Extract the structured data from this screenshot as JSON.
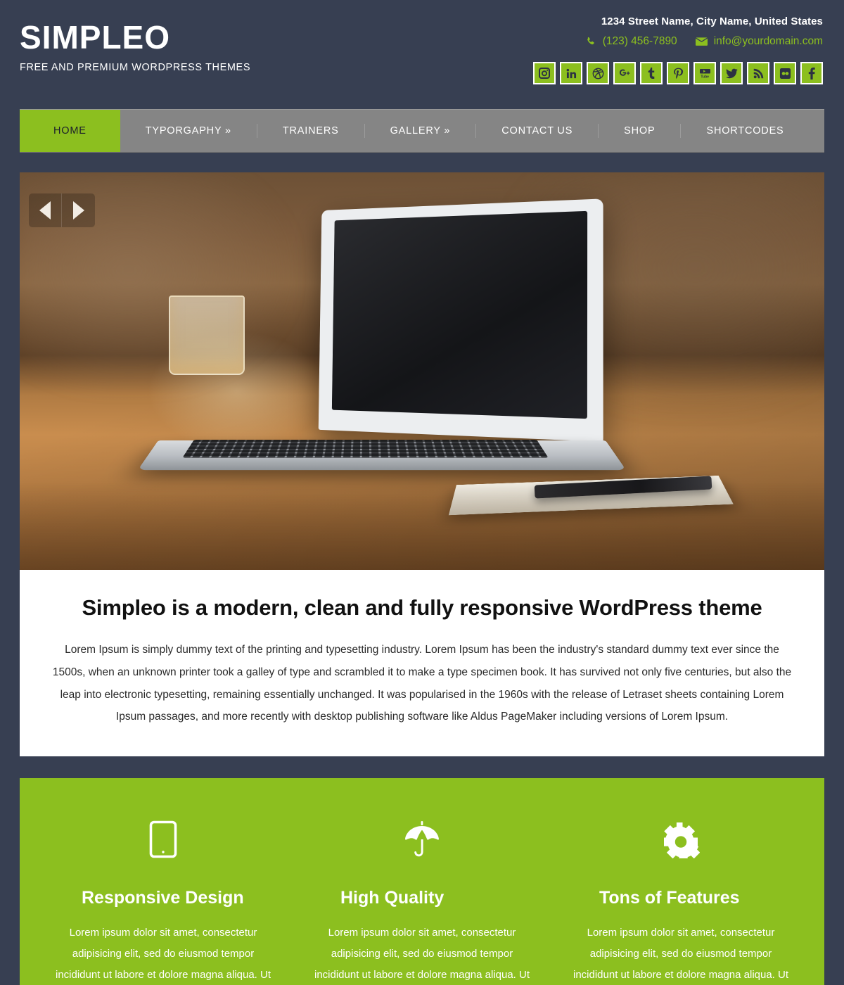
{
  "header": {
    "brand_title": "SIMPLEO",
    "brand_tagline": "FREE AND PREMIUM WORDPRESS THEMES",
    "address": "1234 Street Name, City Name, United States",
    "phone": "(123) 456-7890",
    "email": "info@yourdomain.com",
    "phone_icon": "phone-icon",
    "email_icon": "envelope-icon",
    "social": [
      {
        "name": "instagram-icon",
        "label": "Instagram"
      },
      {
        "name": "linkedin-icon",
        "label": "LinkedIn"
      },
      {
        "name": "dribbble-icon",
        "label": "Dribbble"
      },
      {
        "name": "google-plus-icon",
        "label": "Google Plus"
      },
      {
        "name": "tumblr-icon",
        "label": "Tumblr"
      },
      {
        "name": "pinterest-icon",
        "label": "Pinterest"
      },
      {
        "name": "youtube-icon",
        "label": "YouTube"
      },
      {
        "name": "twitter-icon",
        "label": "Twitter"
      },
      {
        "name": "rss-icon",
        "label": "RSS"
      },
      {
        "name": "flickr-icon",
        "label": "Flickr"
      },
      {
        "name": "facebook-icon",
        "label": "Facebook"
      }
    ]
  },
  "nav": {
    "items": [
      {
        "label": "HOME",
        "active": true
      },
      {
        "label": "TYPORGAPHY »",
        "active": false
      },
      {
        "label": "TRAINERS",
        "active": false
      },
      {
        "label": "GALLERY »",
        "active": false
      },
      {
        "label": "CONTACT US",
        "active": false
      },
      {
        "label": "SHOP",
        "active": false
      },
      {
        "label": "SHORTCODES",
        "active": false
      }
    ]
  },
  "slider": {
    "prev_label": "◀",
    "next_label": "▶",
    "image_alt": "MacBook Air laptop on wooden desk with glass of water, notebook and pen"
  },
  "intro": {
    "title": "Simpleo is a modern, clean and fully responsive WordPress theme",
    "text": "Lorem Ipsum is simply dummy text of the printing and typesetting industry. Lorem Ipsum has been the industry's standard dummy text ever since the 1500s, when an unknown printer took a galley of type and scrambled it to make a type specimen book. It has survived not only five centuries, but also the leap into electronic typesetting, remaining essentially unchanged. It was popularised in the 1960s with the release of Letraset sheets containing Lorem Ipsum passages, and more recently with desktop publishing software like Aldus PageMaker including versions of Lorem Ipsum."
  },
  "features": [
    {
      "icon": "tablet-icon",
      "title": "Responsive Design",
      "text": "Lorem ipsum dolor sit amet, consectetur adipisicing elit, sed do eiusmod tempor incididunt ut labore et dolore magna aliqua. Ut"
    },
    {
      "icon": "umbrella-icon",
      "title": "High Quality",
      "text": "Lorem ipsum dolor sit amet, consectetur adipisicing elit, sed do eiusmod tempor incididunt ut labore et dolore magna aliqua. Ut"
    },
    {
      "icon": "gear-icon",
      "title": "Tons of Features",
      "text": "Lorem ipsum dolor sit amet, consectetur adipisicing elit, sed do eiusmod tempor incididunt ut labore et dolore magna aliqua. Ut"
    }
  ],
  "colors": {
    "background": "#373f52",
    "accent_green": "#8cbf1f",
    "nav_gray": "#858585",
    "white": "#ffffff"
  }
}
